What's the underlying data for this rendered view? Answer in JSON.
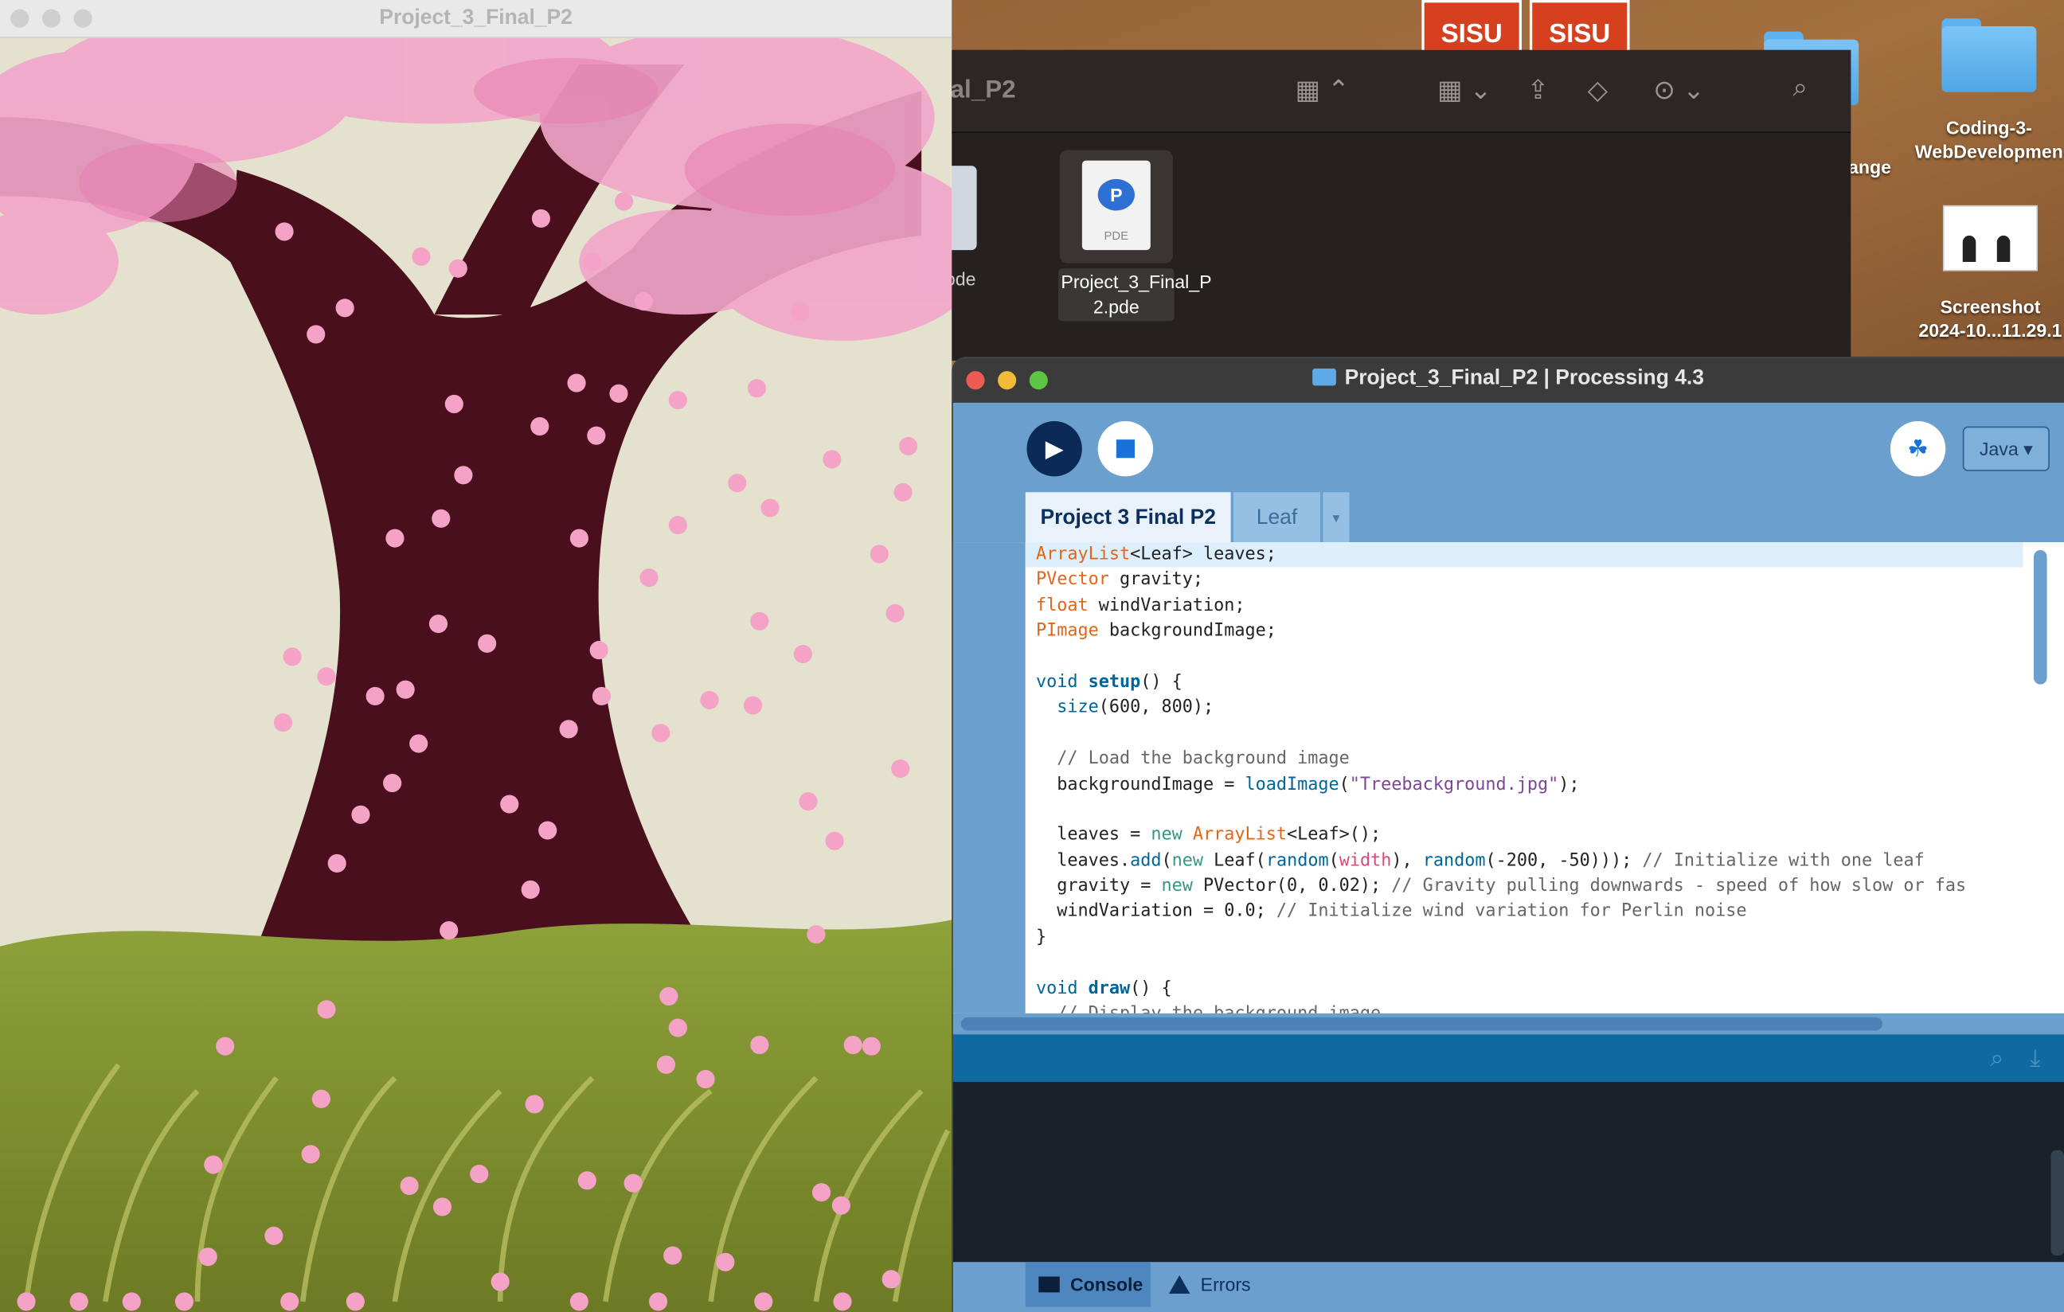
{
  "desktop": {
    "icons": [
      {
        "label": "Coding-3-\nWebDevelopmen",
        "type": "folder"
      },
      {
        "label": "Screenshot\n2024-10...11.29.1",
        "type": "image"
      }
    ],
    "partial_label": "ange",
    "badges": [
      "SISU",
      "SISU"
    ]
  },
  "finder": {
    "title": "al_P2",
    "file_label": "Project_3_Final_P\n2.pde",
    "file_type": "PDE",
    "ghost_label": "ode",
    "icons": [
      "grid-view-icon",
      "group-icon",
      "share-icon",
      "tag-icon",
      "more-icon",
      "search-icon"
    ]
  },
  "sketch": {
    "title": "Project_3_Final_P2"
  },
  "processing": {
    "title": "Project_3_Final_P2 | Processing 4.3",
    "mode": "Java ▾",
    "tabs": [
      "Project 3 Final P2",
      "Leaf"
    ],
    "tab_more": "▾",
    "bottom_tabs": [
      "Console",
      "Errors"
    ],
    "code": [
      "ArrayList<Leaf> leaves;",
      "PVector gravity;",
      "float windVariation;",
      "PImage backgroundImage;",
      "",
      "void setup() {",
      "  size(600, 800);",
      "",
      "  // Load the background image",
      "  backgroundImage = loadImage(\"Treebackground.jpg\");",
      "",
      "  leaves = new ArrayList<Leaf>();",
      "  leaves.add(new Leaf(random(width), random(-200, -50))); // Initialize with one leaf",
      "  gravity = new PVector(0, 0.02); // Gravity pulling downwards - speed of how slow or fas",
      "  windVariation = 0.0; // Initialize wind variation for Perlin noise",
      "}",
      "",
      "void draw() {",
      "  // Display the background image"
    ]
  },
  "colors": {
    "editor_bg": "#6a9fce",
    "code_keyword": "#e2661a",
    "code_function": "#006699",
    "console_bg": "#19212b",
    "run_button": "#0b2a58"
  }
}
